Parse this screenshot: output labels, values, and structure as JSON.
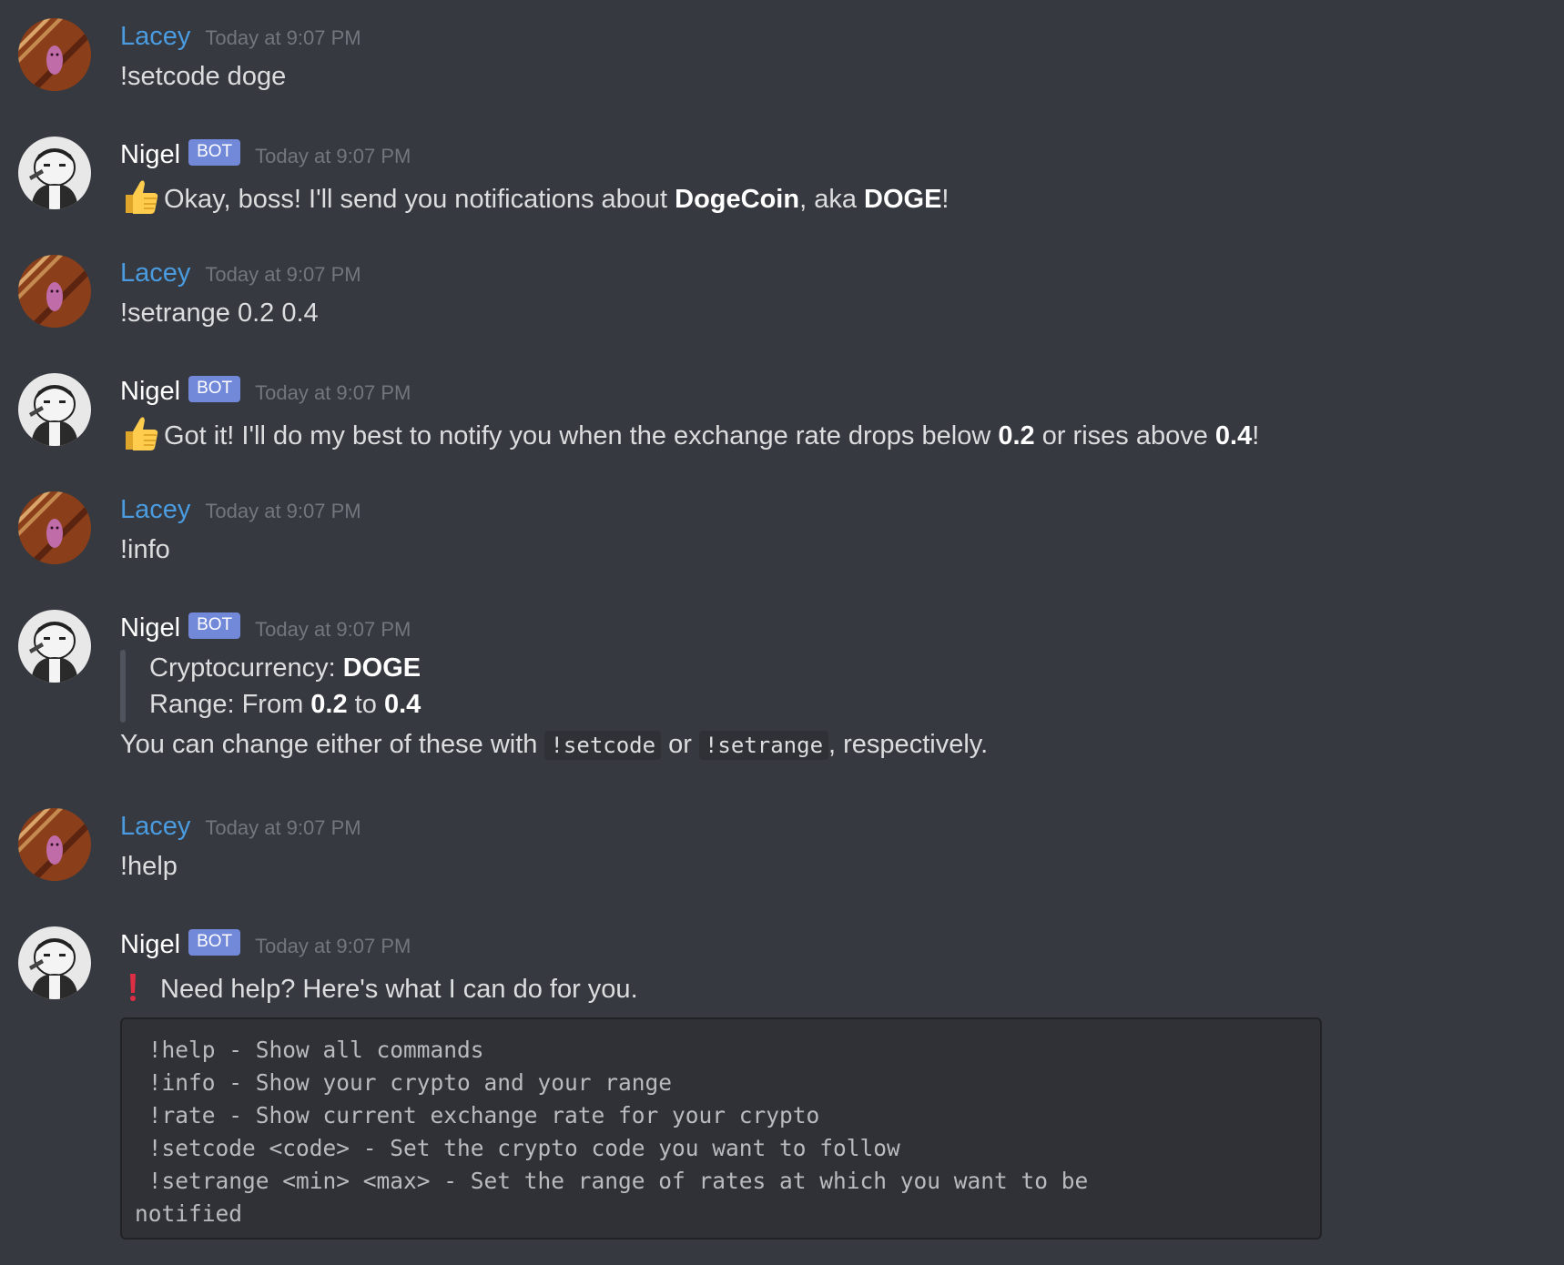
{
  "users": {
    "lacey": {
      "name": "Lacey",
      "color": "#4a9be0"
    },
    "nigel": {
      "name": "Nigel",
      "bot_tag": "BOT",
      "tag_color": "#7289da"
    }
  },
  "messages": [
    {
      "author": "Lacey",
      "timestamp": "Today at 9:07 PM",
      "text": "!setcode doge"
    },
    {
      "author": "Nigel",
      "bot": "BOT",
      "timestamp": "Today at 9:07 PM",
      "emoji": "thumbs-up-icon",
      "parts": [
        "Okay, boss! I'll send you notifications about ",
        "DogeCoin",
        ", aka ",
        "DOGE",
        "!"
      ]
    },
    {
      "author": "Lacey",
      "timestamp": "Today at 9:07 PM",
      "text": "!setrange 0.2 0.4"
    },
    {
      "author": "Nigel",
      "bot": "BOT",
      "timestamp": "Today at 9:07 PM",
      "emoji": "thumbs-up-icon",
      "parts": [
        "Got it! I'll do my best to notify you when the exchange rate drops below ",
        "0.2",
        " or rises above ",
        "0.4",
        "!"
      ]
    },
    {
      "author": "Lacey",
      "timestamp": "Today at 9:07 PM",
      "text": "!info"
    },
    {
      "author": "Nigel",
      "bot": "BOT",
      "timestamp": "Today at 9:07 PM",
      "quote": {
        "line1_label": "Cryptocurrency: ",
        "line1_value": "DOGE",
        "line2_label": "Range: From ",
        "line2_min": "0.2",
        "line2_mid": " to ",
        "line2_max": "0.4"
      },
      "footer": {
        "before": "You can change either of these with ",
        "code1": "!setcode",
        "middle": " or ",
        "code2": "!setrange",
        "after": ", respectively."
      }
    },
    {
      "author": "Lacey",
      "timestamp": "Today at 9:07 PM",
      "text": "!help"
    },
    {
      "author": "Nigel",
      "bot": "BOT",
      "timestamp": "Today at 9:07 PM",
      "emoji": "exclamation-icon",
      "text": "Need help? Here's what I can do for you.",
      "code_lines": [
        " !help - Show all commands",
        " !info - Show your crypto and your range",
        " !rate - Show current exchange rate for your crypto",
        " !setcode <code> - Set the crypto code you want to follow",
        " !setrange <min> <max> - Set the range of rates at which you want to be",
        "notified"
      ]
    }
  ]
}
